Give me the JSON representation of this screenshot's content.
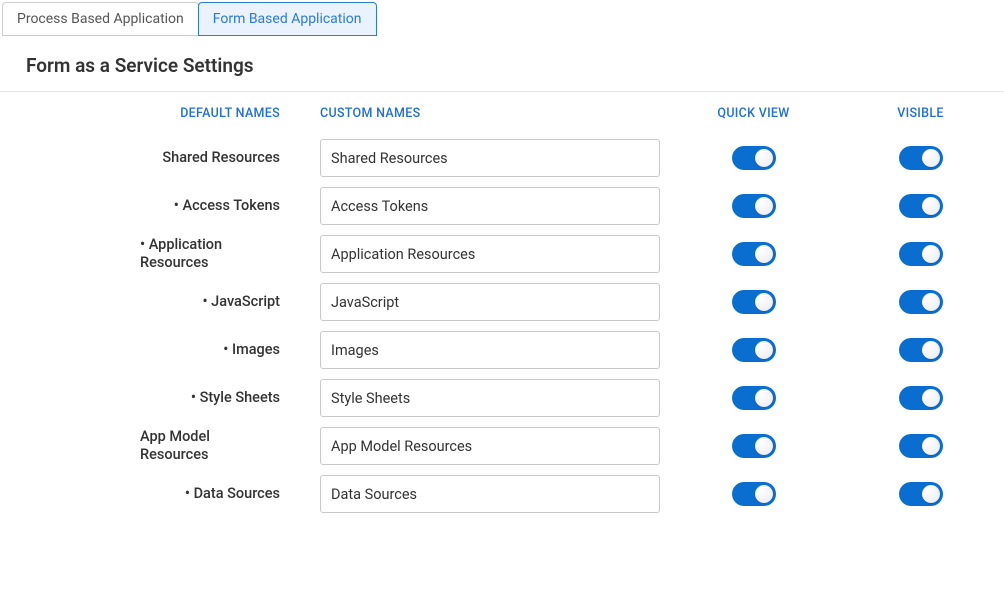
{
  "tabs": {
    "process": "Process Based Application",
    "form": "Form Based Application"
  },
  "pageTitle": "Form as a Service Settings",
  "headers": {
    "default": "DEFAULT NAMES",
    "custom": "CUSTOM NAMES",
    "quickview": "QUICK VIEW",
    "visible": "VISIBLE"
  },
  "rows": [
    {
      "label": "Shared Resources",
      "value": "Shared Resources",
      "indent": false,
      "quickview": true,
      "visible": true
    },
    {
      "label": "Access Tokens",
      "value": "Access Tokens",
      "indent": true,
      "quickview": true,
      "visible": true
    },
    {
      "label": "Application Resources",
      "value": "Application Resources",
      "indent": true,
      "quickview": true,
      "visible": true
    },
    {
      "label": "JavaScript",
      "value": "JavaScript",
      "indent": true,
      "quickview": true,
      "visible": true
    },
    {
      "label": "Images",
      "value": "Images",
      "indent": true,
      "quickview": true,
      "visible": true
    },
    {
      "label": "Style Sheets",
      "value": "Style Sheets",
      "indent": true,
      "quickview": true,
      "visible": true
    },
    {
      "label": "App Model Resources",
      "value": "App Model Resources",
      "indent": false,
      "quickview": true,
      "visible": true
    },
    {
      "label": "Data Sources",
      "value": "Data Sources",
      "indent": true,
      "quickview": true,
      "visible": true
    }
  ]
}
